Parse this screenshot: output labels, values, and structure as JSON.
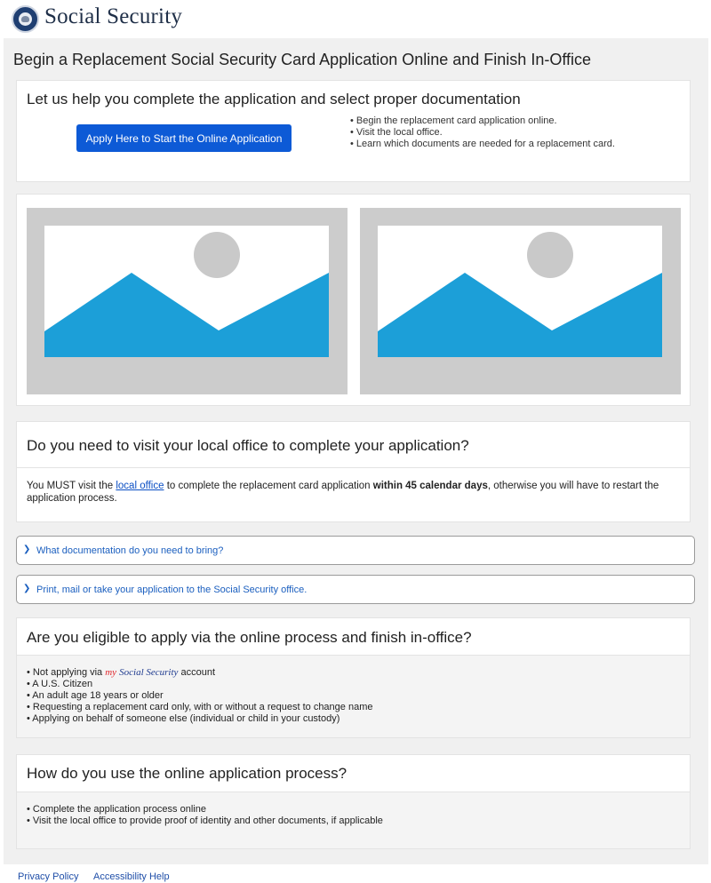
{
  "header": {
    "brand": "Social Security",
    "logo_icon": "ssa-seal-icon"
  },
  "page": {
    "title": "Begin a Replacement Social Security Card Application Online and Finish In-Office"
  },
  "intro_card": {
    "heading": "Let us help you complete the application and select proper documentation",
    "apply_button": "Apply Here to Start the Online Application",
    "bullets": [
      "• Begin the replacement card application online.",
      "• Visit the local office.",
      "• Learn which documents are needed for a replacement card."
    ]
  },
  "image_placeholders": {
    "icon": "image-placeholder-icon",
    "colors": {
      "frame": "#cccccc",
      "sky": "#ffffff",
      "sun": "#c9c9c9",
      "mountain": "#1c9fd8"
    }
  },
  "visit_card": {
    "heading": "Do you need to visit your local office to complete your application?",
    "text_before": "You MUST visit the ",
    "link": "local office",
    "text_middle": " to complete the replacement card application ",
    "bold": "within 45 calendar days",
    "text_after": ", otherwise you will have to restart the application process."
  },
  "accordions": [
    {
      "label": "What documentation do you need to bring?",
      "icon": "chevron-down-icon"
    },
    {
      "label": "Print, mail or take your application to the Social Security office.",
      "icon": "chevron-down-icon"
    }
  ],
  "eligibility_card": {
    "heading": "Are you eligible to apply via the online process and finish in-office?",
    "first_prefix": "• Not applying via ",
    "my": "my",
    "ss": "Social Security",
    "first_suffix": " account",
    "items": [
      "• A U.S. Citizen",
      "• An adult age 18 years or older",
      "• Requesting a replacement card only, with or without a request to change name",
      "• Applying on behalf of someone else (individual or child in your custody)"
    ]
  },
  "usage_card": {
    "heading": "How do you use the online application process?",
    "items": [
      "• Complete the application process online",
      "• Visit the local office to provide proof of identity and other documents, if applicable"
    ]
  },
  "footer": {
    "privacy": "Privacy Policy",
    "accessibility": "Accessibility Help"
  },
  "colors": {
    "button": "#0d5ad6",
    "link": "#1b5fbf",
    "background": "#f0f0f0"
  }
}
